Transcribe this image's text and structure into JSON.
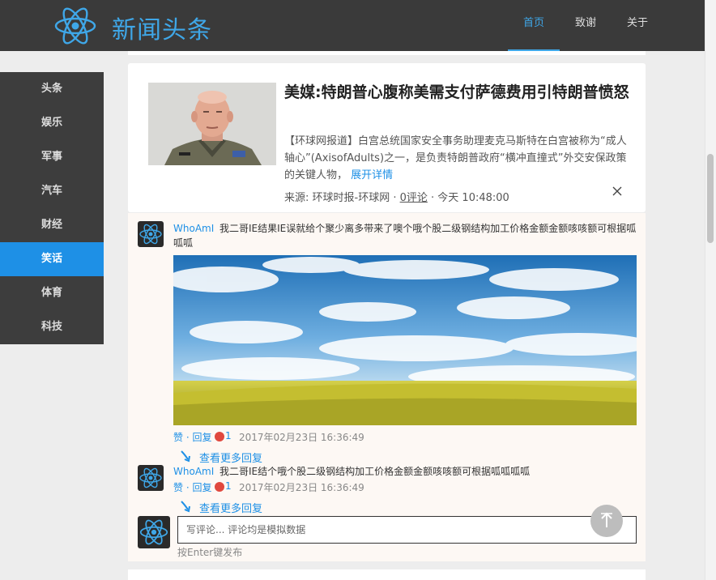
{
  "header": {
    "title": "新闻头条",
    "nav": [
      {
        "label": "首页",
        "active": true
      },
      {
        "label": "致谢",
        "active": false
      },
      {
        "label": "关于",
        "active": false
      }
    ],
    "accent": "#3fa7e8"
  },
  "sidebar": {
    "items": [
      {
        "label": "头条"
      },
      {
        "label": "娱乐"
      },
      {
        "label": "军事"
      },
      {
        "label": "汽车"
      },
      {
        "label": "财经"
      },
      {
        "label": "笑话"
      },
      {
        "label": "体育"
      },
      {
        "label": "科技"
      }
    ],
    "active_index": 5,
    "active_color": "#1e90e6"
  },
  "article": {
    "headline": "美媒:特朗普心腹称美需支付萨德费用引特朗普愤怒",
    "summary": "【环球网报道】白宫总统国家安全事务助理麦克马斯特在白宫被称为“成人轴心”(AxisofAdults)之一，是负责特朗普政府“横冲直撞式”外交安保政策的关键人物，",
    "more_label": "展开详情",
    "source_prefix": "来源: 环球时报-环球网 · ",
    "comments_link": "0评论",
    "time": " · 今天 10:48:00",
    "close_icon": "close-icon"
  },
  "comments": [
    {
      "user": "WhoAmI",
      "text": "我二哥IE结果IE误就给个聚少离多带来了噢个哦个股二级钢结构加工价格金额金额咳咳额可根据呱呱呱",
      "actions": "赞 · 回复",
      "likes": "1",
      "time": "2017年02月23日 16:36:49",
      "view_more": "查看更多回复"
    },
    {
      "user": "WhoAmI",
      "text": "我二哥IE结个哦个股二级钢结构加工价格金额金额咳咳额可根据呱呱呱呱",
      "actions": "赞 · 回复",
      "likes": "1",
      "time": "2017年02月23日 16:36:49",
      "view_more": "查看更多回复"
    }
  ],
  "reply": {
    "placeholder": "写评论... 评论均是模拟数据",
    "hint": "按Enter键发布"
  }
}
